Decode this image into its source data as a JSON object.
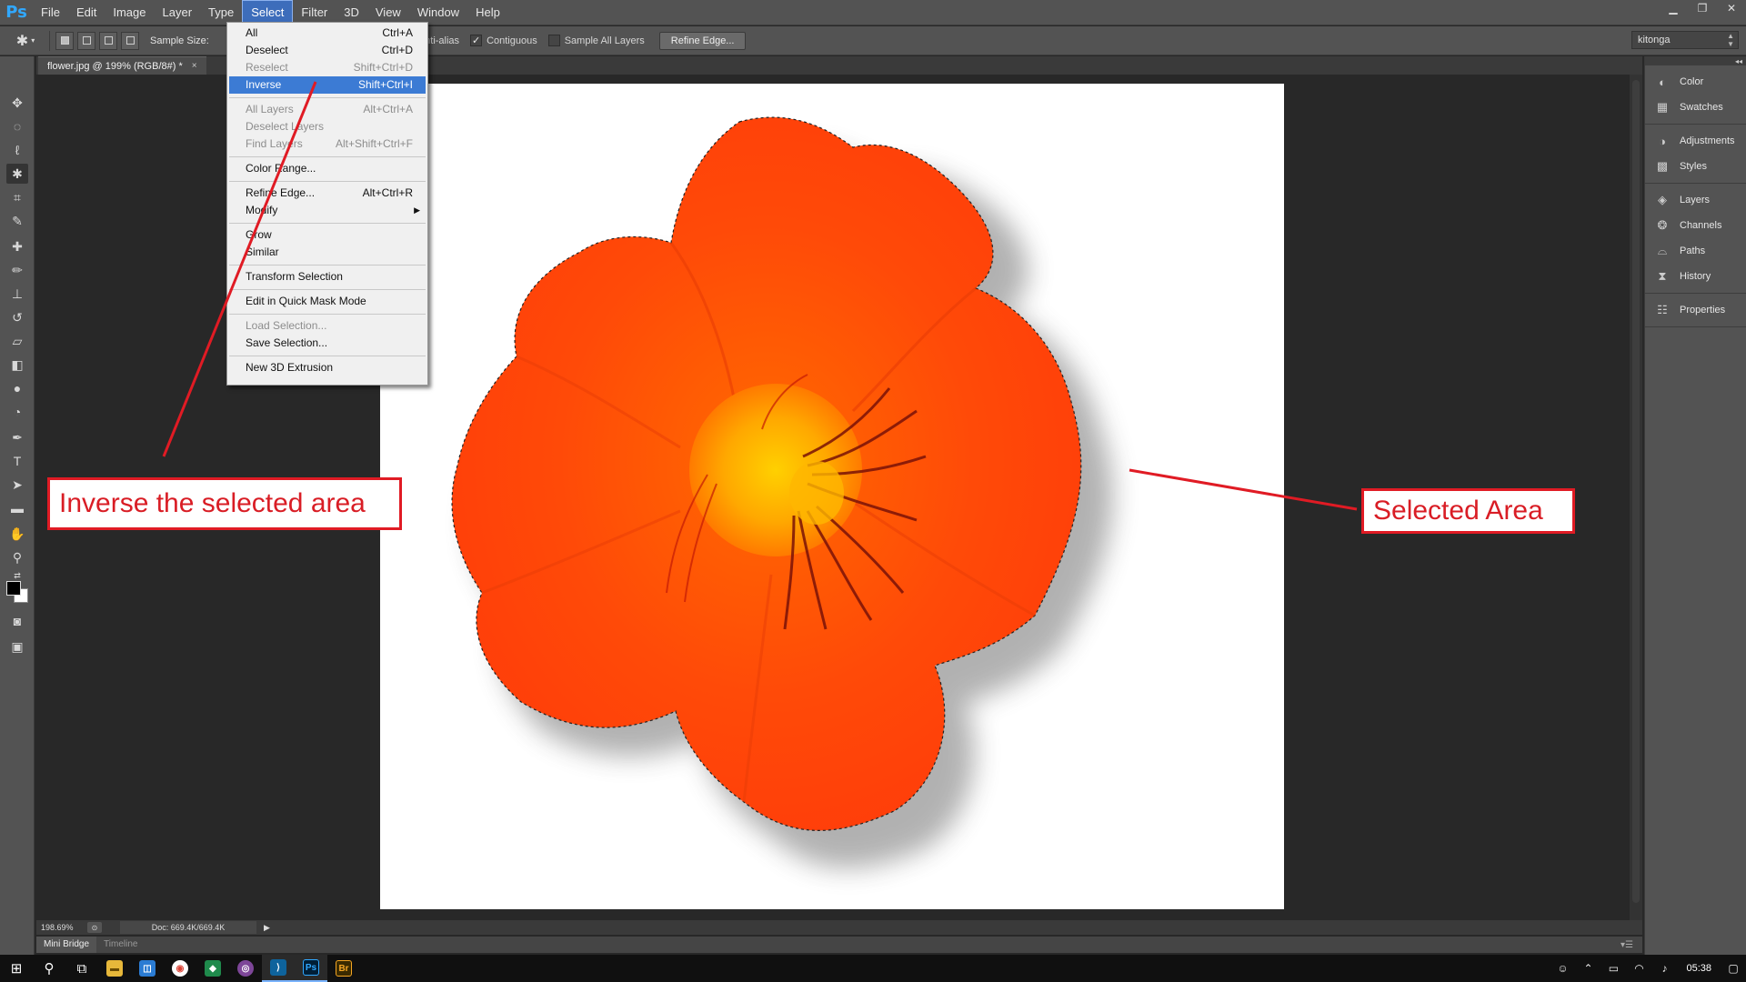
{
  "app": {
    "logo": "Ps",
    "menus": [
      "File",
      "Edit",
      "Image",
      "Layer",
      "Type",
      "Select",
      "Filter",
      "3D",
      "View",
      "Window",
      "Help"
    ],
    "active_menu": "Select"
  },
  "window_controls": {
    "minimize": "▁",
    "restore": "❐",
    "close": "✕"
  },
  "options_bar": {
    "sample_size_label": "Sample Size:",
    "anti_alias_label": "Anti-alias",
    "anti_alias_checked": true,
    "contiguous_label": "Contiguous",
    "contiguous_checked": true,
    "sample_all_layers_label": "Sample All Layers",
    "sample_all_layers_checked": false,
    "refine_edge_label": "Refine Edge...",
    "workspace_value": "kitonga"
  },
  "document_tab": {
    "title": "flower.jpg @ 199% (RGB/8#) *",
    "close": "×"
  },
  "select_menu": {
    "items": [
      {
        "label": "All",
        "shortcut": "Ctrl+A",
        "state": "normal"
      },
      {
        "label": "Deselect",
        "shortcut": "Ctrl+D",
        "state": "normal"
      },
      {
        "label": "Reselect",
        "shortcut": "Shift+Ctrl+D",
        "state": "disabled"
      },
      {
        "label": "Inverse",
        "shortcut": "Shift+Ctrl+I",
        "state": "highlight"
      },
      {
        "label": "All Layers",
        "shortcut": "Alt+Ctrl+A",
        "state": "disabled"
      },
      {
        "label": "Deselect Layers",
        "shortcut": "",
        "state": "disabled"
      },
      {
        "label": "Find Layers",
        "shortcut": "Alt+Shift+Ctrl+F",
        "state": "disabled"
      },
      {
        "label": "Color Range...",
        "shortcut": "",
        "state": "normal"
      },
      {
        "label": "Refine Edge...",
        "shortcut": "Alt+Ctrl+R",
        "state": "normal"
      },
      {
        "label": "Modify",
        "shortcut": "",
        "state": "normal",
        "submenu": "▶"
      },
      {
        "label": "Grow",
        "shortcut": "",
        "state": "normal"
      },
      {
        "label": "Similar",
        "shortcut": "",
        "state": "normal"
      },
      {
        "label": "Transform Selection",
        "shortcut": "",
        "state": "normal"
      },
      {
        "label": "Edit in Quick Mask Mode",
        "shortcut": "",
        "state": "normal"
      },
      {
        "label": "Load Selection...",
        "shortcut": "",
        "state": "disabled"
      },
      {
        "label": "Save Selection...",
        "shortcut": "",
        "state": "normal"
      },
      {
        "label": "New 3D Extrusion",
        "shortcut": "",
        "state": "normal"
      }
    ]
  },
  "right_panels": [
    {
      "group": [
        {
          "label": "Color",
          "icon": "color-icon"
        },
        {
          "label": "Swatches",
          "icon": "swatches-icon"
        }
      ]
    },
    {
      "group": [
        {
          "label": "Adjustments",
          "icon": "adjustments-icon"
        },
        {
          "label": "Styles",
          "icon": "styles-icon"
        }
      ]
    },
    {
      "group": [
        {
          "label": "Layers",
          "icon": "layers-icon"
        },
        {
          "label": "Channels",
          "icon": "channels-icon"
        },
        {
          "label": "Paths",
          "icon": "paths-icon"
        },
        {
          "label": "History",
          "icon": "history-icon"
        }
      ]
    },
    {
      "group": [
        {
          "label": "Properties",
          "icon": "properties-icon"
        }
      ]
    }
  ],
  "status_bar": {
    "zoom": "198.69%",
    "doc_info": "Doc: 669.4K/669.4K"
  },
  "bottom_tabs": [
    "Mini Bridge",
    "Timeline"
  ],
  "annotations": {
    "inverse_label": "Inverse the selected area",
    "selected_label": "Selected Area",
    "color": "#e01b24"
  },
  "taskbar": {
    "clock": "05:38",
    "apps": [
      "start",
      "search",
      "task-view",
      "file-explorer",
      "store",
      "chrome",
      "sourcetree",
      "tor-browser",
      "vscode",
      "photoshop",
      "bridge"
    ]
  },
  "colors": {
    "accent": "#3c7bd4",
    "flower_orange": "#ff4a06",
    "flower_center": "#ffb300"
  }
}
